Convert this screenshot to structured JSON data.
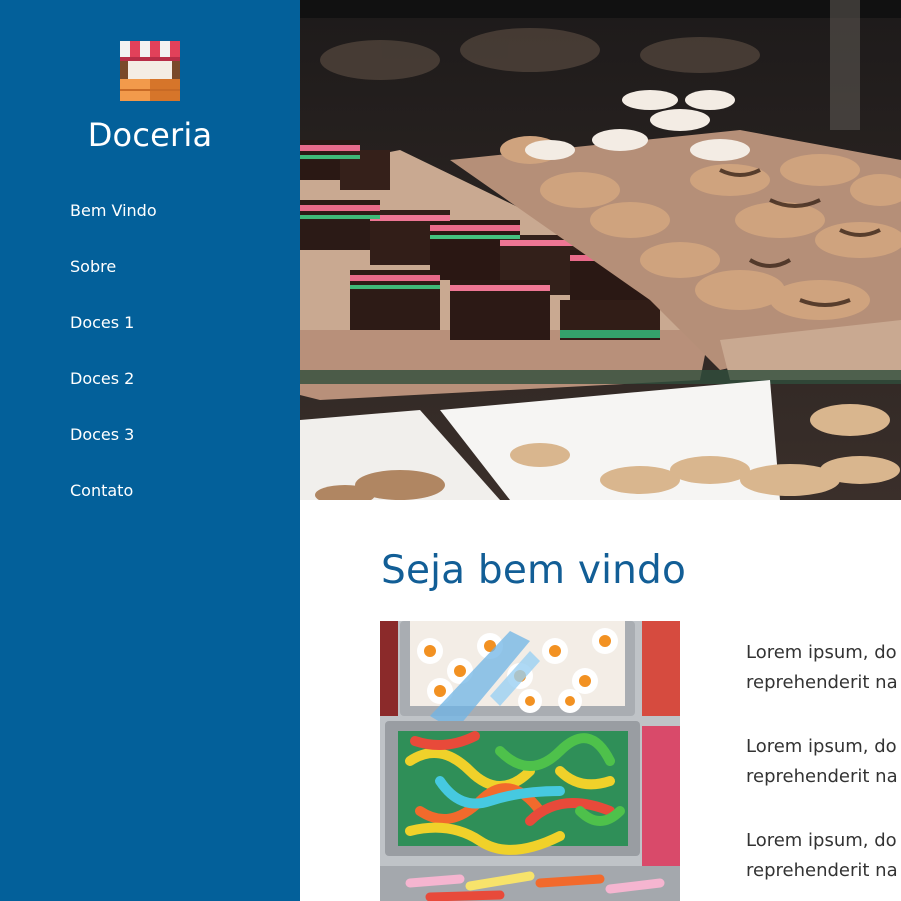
{
  "sidebar": {
    "brand": "Doceria",
    "logo_icon": "shop-awning-icon",
    "nav": [
      {
        "label": "Bem Vindo"
      },
      {
        "label": "Sobre"
      },
      {
        "label": "Doces 1"
      },
      {
        "label": "Doces 2"
      },
      {
        "label": "Doces 3"
      },
      {
        "label": "Contato"
      }
    ]
  },
  "hero": {
    "image": "bakery-display-photo"
  },
  "main": {
    "title": "Seja bem vindo",
    "image": "gummy-candy-bins-photo",
    "paragraphs": [
      {
        "line1": "Lorem ipsum, do",
        "line2": "reprehenderit na"
      },
      {
        "line1": "Lorem ipsum, do",
        "line2": "reprehenderit na"
      },
      {
        "line1": "Lorem ipsum, do",
        "line2": "reprehenderit na"
      }
    ]
  },
  "colors": {
    "sidebar": "#03609a",
    "title": "#125e96",
    "text": "#333333"
  }
}
